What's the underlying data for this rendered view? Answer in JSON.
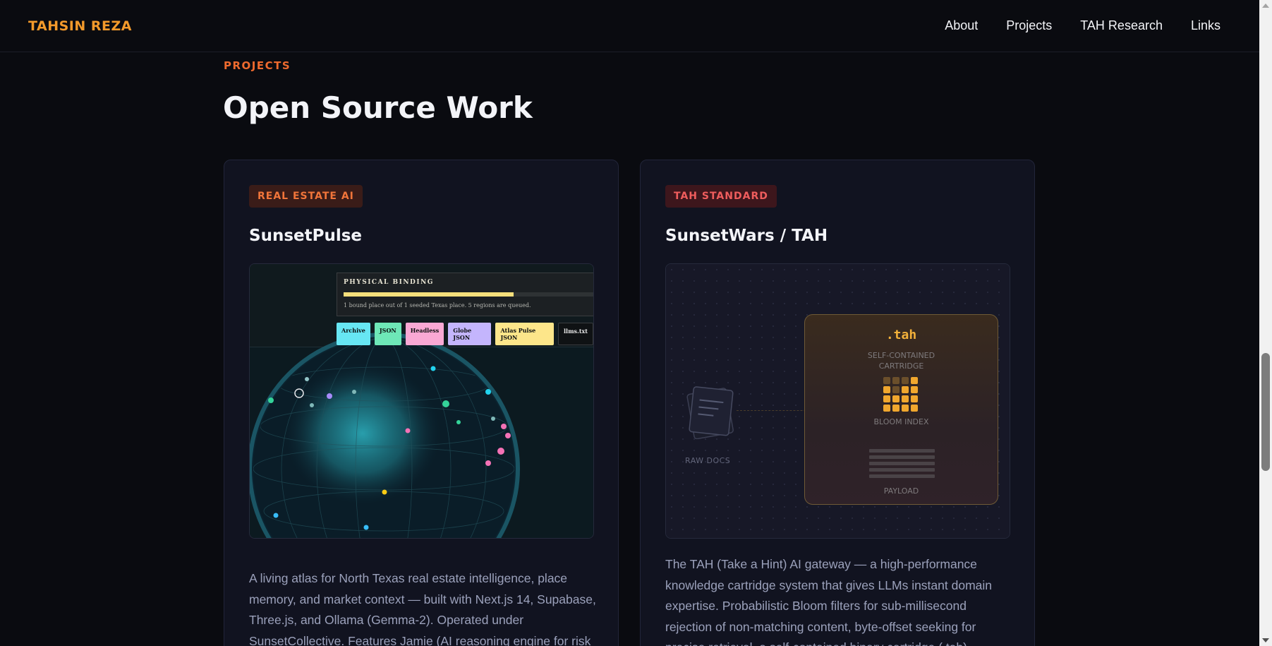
{
  "header": {
    "brand": "TAHSIN REZA",
    "nav": [
      "About",
      "Projects",
      "TAH Research",
      "Links"
    ]
  },
  "section": {
    "eyebrow": "PROJECTS",
    "title": "Open Source Work"
  },
  "cards": [
    {
      "badge": "REAL ESTATE AI",
      "title": "SunsetPulse",
      "preview": {
        "panel_title": "PHYSICAL BINDING",
        "progress": 0.65,
        "panel_note": "1 bound place out of 1 seeded Texas place. 5 regions are queued.",
        "chips": [
          {
            "label": "Archive",
            "color": "#67e6f3"
          },
          {
            "label": "JSON",
            "color": "#6ee7b7"
          },
          {
            "label": "Headless",
            "color": "#f9a8d4"
          },
          {
            "label": "Globe JSON",
            "color": "#c4b5fd"
          },
          {
            "label": "Atlas Pulse JSON",
            "color": "#fde68a"
          },
          {
            "label": "llms.txt",
            "color": "#0f1214"
          }
        ]
      },
      "description": "A living atlas for North Texas real estate intelligence, place memory, and market context — built with Next.js 14, Supabase, Three.js, and Ollama (Gemma-2). Operated under SunsetCollective. Features Jamie (AI reasoning engine for risk"
    },
    {
      "badge": "TAH STANDARD",
      "title": "SunsetWars / TAH",
      "preview": {
        "ext": ".tah",
        "subtitle_1": "SELF-CONTAINED",
        "subtitle_2": "CARTRIDGE",
        "bloom_label": "BLOOM INDEX",
        "payload_label": "PAYLOAD",
        "raw_label": "RAW DOCS"
      },
      "description": "The TAH (Take a Hint) AI gateway — a high-performance knowledge cartridge system that gives LLMs instant domain expertise. Probabilistic Bloom filters for sub-millisecond rejection of non-matching content, byte-offset seeking for precise retrieval, a self-contained binary cartridge (.tah)"
    }
  ],
  "colors": {
    "accent_orange": "#f39a2b",
    "eyebrow": "#ee6a2e",
    "background": "#0a0b10",
    "card": "#111320"
  }
}
